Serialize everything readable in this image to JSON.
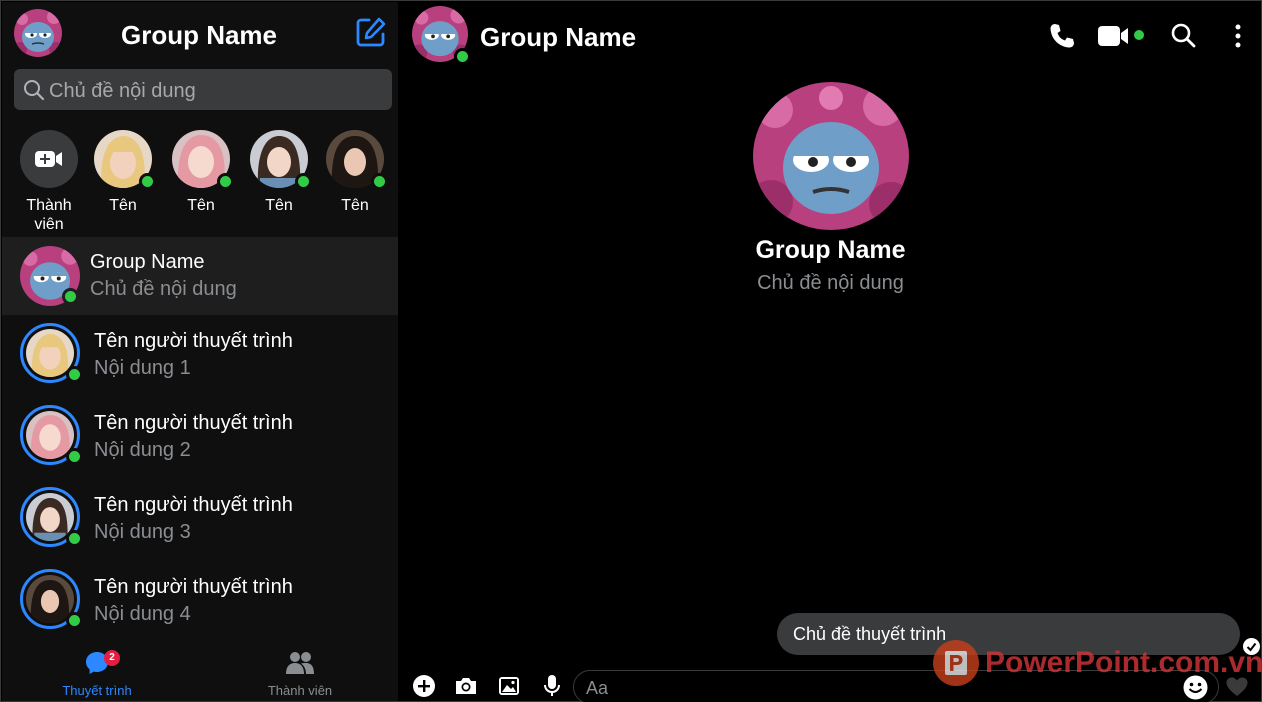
{
  "sidebar": {
    "title": "Group Name",
    "search_placeholder": "Chủ đề nội dung",
    "stories": [
      {
        "label": "Thành viên"
      },
      {
        "label": "Tên"
      },
      {
        "label": "Tên"
      },
      {
        "label": "Tên"
      },
      {
        "label": "Tên"
      }
    ],
    "conversations": [
      {
        "name": "Group Name",
        "sub": "Chủ đề nội dung",
        "active": true
      },
      {
        "name": "Tên người thuyết trình",
        "sub": "Nội dung 1"
      },
      {
        "name": "Tên người thuyết trình",
        "sub": "Nội dung 2"
      },
      {
        "name": "Tên người thuyết trình",
        "sub": "Nội dung 3"
      },
      {
        "name": "Tên người thuyết trình",
        "sub": "Nội dung 4"
      }
    ],
    "nav": [
      {
        "label": "Thuyết trình",
        "badge": "2",
        "active": true
      },
      {
        "label": "Thành viên"
      }
    ]
  },
  "header": {
    "title": "Group Name",
    "icons": [
      "phone-icon",
      "video-call-icon",
      "search-icon",
      "more-options-icon"
    ]
  },
  "chat": {
    "name": "Group Name",
    "sub": "Chủ đề nội dung",
    "messages": [
      {
        "text": "Chủ đề thuyết trình"
      }
    ]
  },
  "composer": {
    "placeholder": "Aa",
    "icons": [
      "plus-icon",
      "camera-icon",
      "image-icon",
      "microphone-icon",
      "emoji-icon",
      "heart-icon"
    ]
  },
  "watermark": {
    "text": "PowerPoint.com.vn"
  },
  "colors": {
    "accent": "#2d88ff",
    "online": "#31cc46",
    "badge": "#e41e3f",
    "sidebar_bg": "#0f0f0f",
    "input_bg": "#3a3b3c",
    "muted_text": "#8a8d91"
  }
}
